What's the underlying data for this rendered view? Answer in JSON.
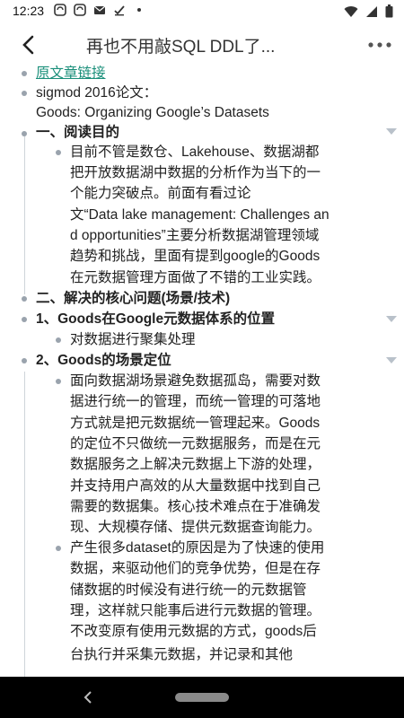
{
  "status": {
    "time": "12:23"
  },
  "header": {
    "title": "再也不用敲SQL DDL了..."
  },
  "outline": {
    "link_text": "原文章链接",
    "paper_line1": "sigmod 2016论文：",
    "paper_line2": "Goods: Organizing Google’s Datasets",
    "h1": "一、阅读目的",
    "p1": [
      "目前不管是数仓、Lakehouse、数据湖都",
      "把开放数据湖中数据的分析作为当下的一",
      "个能力突破点。前面有看过论",
      "文“Data lake management: Challenges an",
      "d opportunities”主要分析数据湖管理领域",
      "趋势和挑战，里面有提到google的Goods",
      "在元数据管理方面做了不错的工业实践。"
    ],
    "h2": "二、解决的核心问题(场景/技术)",
    "h3": "1、Goods在Google元数据体系的位置",
    "p2": "对数据进行聚集处理",
    "h4": "2、Goods的场景定位",
    "p3": [
      "面向数据湖场景避免数据孤岛，需要对数",
      "据进行统一的管理，而统一管理的可落地",
      "方式就是把元数据统一管理起来。Goods",
      "的定位不只做统一元数据服务，而是在元",
      "数据服务之上解决元数据上下游的处理，",
      "并支持用户高效的从大量数据中找到自己",
      "需要的数据集。核心技术难点在于准确发",
      "现、大规模存储、提供元数据查询能力。"
    ],
    "p4": [
      "产生很多dataset的原因是为了快速的使用",
      "数据，来驱动他们的竞争优势，但是在存",
      "储数据的时候没有进行统一的元数据管",
      "理，这样就只能事后进行元数据的管理。",
      "不改变原有使用元数据的方式，goods后",
      "台执行并采集元数据，并记录和其他"
    ]
  }
}
